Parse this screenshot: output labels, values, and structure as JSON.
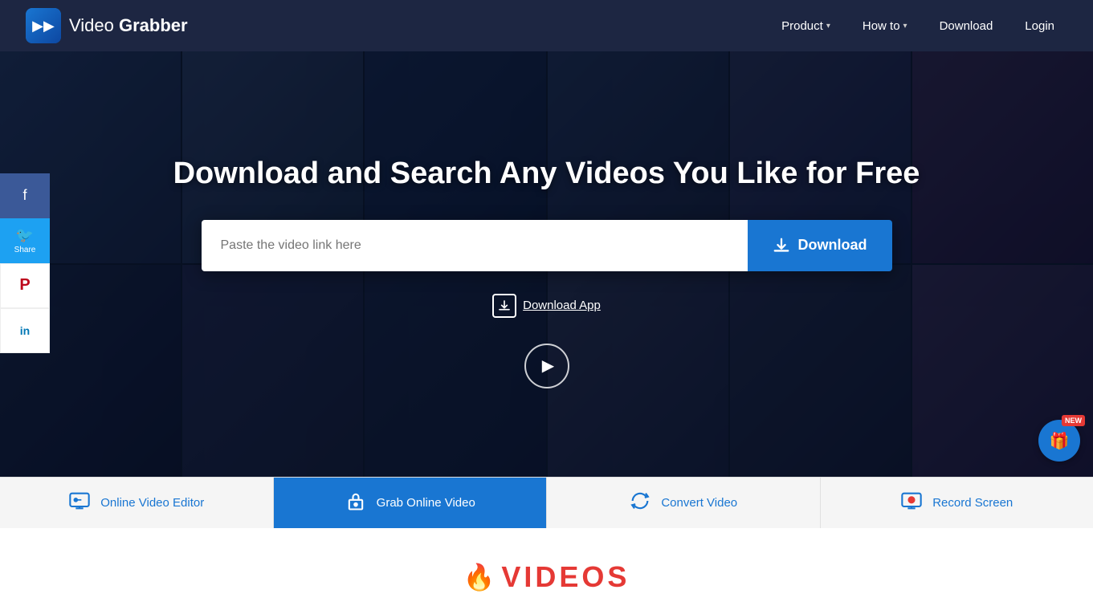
{
  "navbar": {
    "logo_text_normal": "Video ",
    "logo_text_bold": "Grabber",
    "nav_items": [
      {
        "id": "product",
        "label": "Product",
        "has_dropdown": true
      },
      {
        "id": "howto",
        "label": "How to",
        "has_dropdown": true
      },
      {
        "id": "download",
        "label": "Download",
        "has_dropdown": false
      }
    ],
    "login_label": "Login"
  },
  "hero": {
    "title": "Download and Search Any Videos You Like for Free",
    "search_placeholder": "Paste the video link here",
    "download_button_label": "Download",
    "download_app_label": "Download App"
  },
  "social": {
    "share_label": "Share",
    "items": [
      {
        "id": "facebook",
        "icon": "f",
        "label": ""
      },
      {
        "id": "twitter",
        "icon": "🐦",
        "label": "Share"
      },
      {
        "id": "pinterest",
        "icon": "P",
        "label": ""
      },
      {
        "id": "linkedin",
        "icon": "in",
        "label": ""
      }
    ]
  },
  "bottom_nav": {
    "items": [
      {
        "id": "online-video-editor",
        "label": "Online Video Editor",
        "active": false
      },
      {
        "id": "grab-online-video",
        "label": "Grab Online Video",
        "active": true
      },
      {
        "id": "convert-video",
        "label": "Convert Video",
        "active": false
      },
      {
        "id": "record-screen",
        "label": "Record Screen",
        "active": false
      }
    ]
  },
  "new_badge": {
    "label": "NEW"
  },
  "videos_section": {
    "title": "VIDEOS"
  }
}
